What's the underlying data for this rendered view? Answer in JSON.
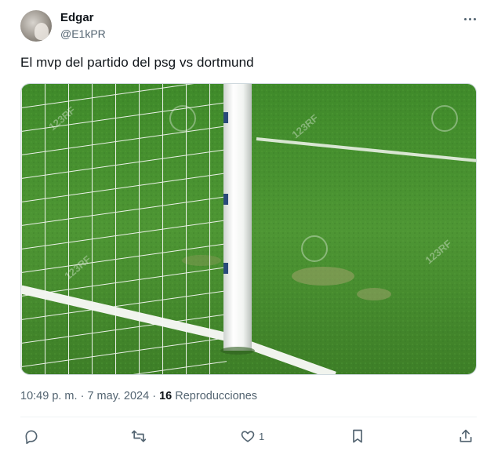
{
  "author": {
    "display_name": "Edgar",
    "handle": "@E1kPR"
  },
  "tweet": {
    "text": "El mvp del partido del psg vs dortmund",
    "image_watermark": "123RF"
  },
  "meta": {
    "time": "10:49 p. m.",
    "separator": "·",
    "date": "7 may. 2024",
    "views_count": "16",
    "views_label": "Reproducciones"
  },
  "actions": {
    "like_count": "1"
  },
  "icons": [
    "more-icon",
    "reply-icon",
    "retweet-icon",
    "like-icon",
    "bookmark-icon",
    "share-icon"
  ],
  "colors": {
    "text": "#0f1419",
    "muted": "#536471",
    "grass": "#4f8f34"
  }
}
